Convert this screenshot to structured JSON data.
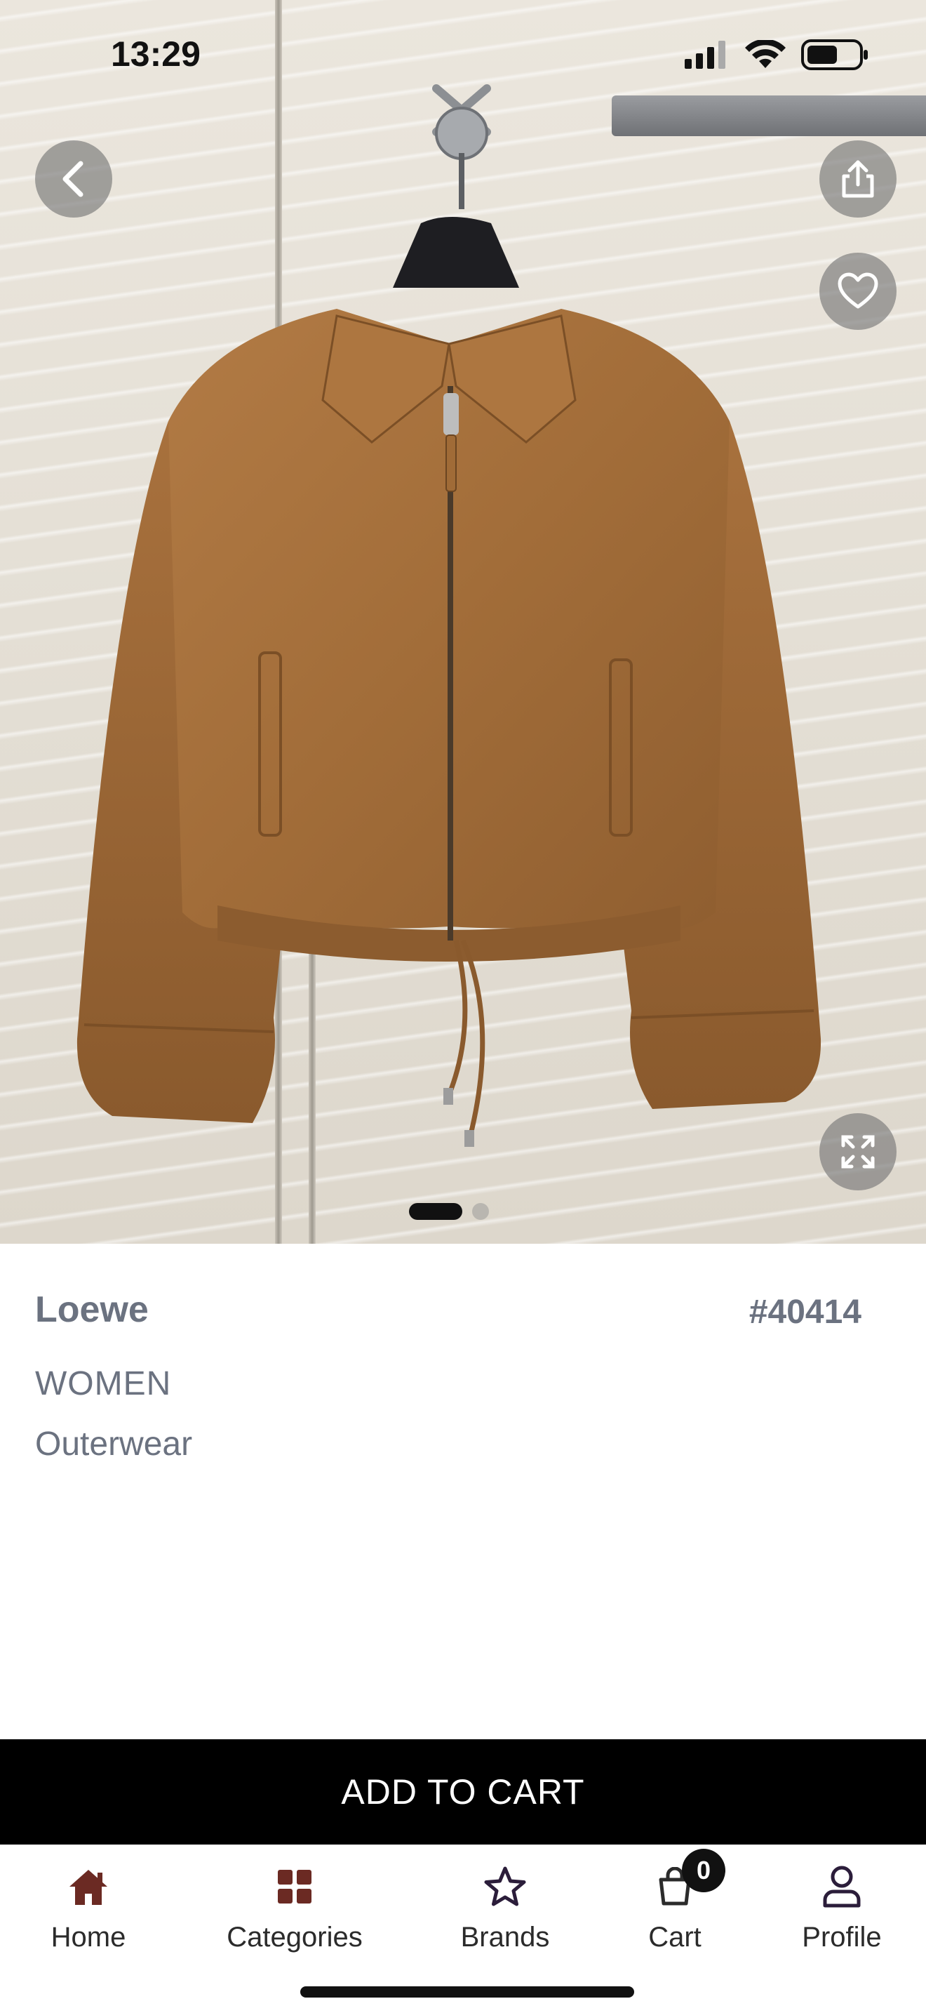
{
  "status_bar": {
    "time": "13:29"
  },
  "product": {
    "brand": "Loewe",
    "code": "#40414",
    "gender": "WOMEN",
    "category": "Outerwear"
  },
  "gallery": {
    "current_index": 1,
    "total": 2
  },
  "actions": {
    "add_to_cart_label": "ADD TO CART"
  },
  "nav": {
    "items": [
      {
        "label": "Home",
        "icon": "home-icon"
      },
      {
        "label": "Categories",
        "icon": "grid-icon"
      },
      {
        "label": "Brands",
        "icon": "star-icon"
      },
      {
        "label": "Cart",
        "icon": "cart-icon",
        "badge": "0"
      },
      {
        "label": "Profile",
        "icon": "profile-icon"
      }
    ]
  },
  "colors": {
    "accent": "#000000",
    "muted_text": "#6b7280",
    "jacket": "#a8723c"
  }
}
